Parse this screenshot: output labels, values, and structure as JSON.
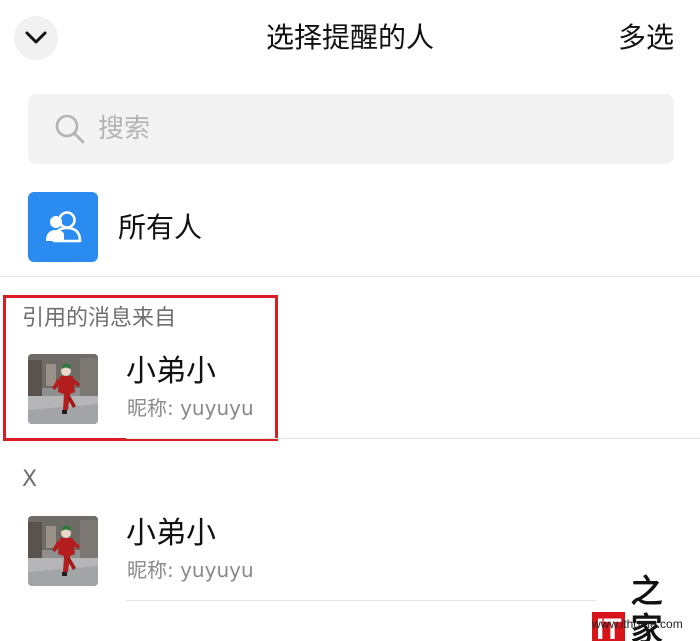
{
  "header": {
    "title": "选择提醒的人",
    "multi_select_label": "多选"
  },
  "search": {
    "placeholder": "搜索",
    "value": ""
  },
  "everyone": {
    "label": "所有人",
    "icon": "group-icon",
    "color": "#2a8cf0"
  },
  "sections": [
    {
      "title": "引用的消息来自",
      "contacts": [
        {
          "name": "小弟小",
          "nickname": "昵称: yuyuyu"
        }
      ]
    },
    {
      "title": "X",
      "contacts": [
        {
          "name": "小弟小",
          "nickname": "昵称: yuyuyu"
        }
      ]
    }
  ],
  "highlight_color": "#d81e22",
  "watermark": {
    "logo_it": "IT",
    "logo_zhi": "之家",
    "url": "www.ithome.com",
    "brand_color": "#d7141a"
  }
}
